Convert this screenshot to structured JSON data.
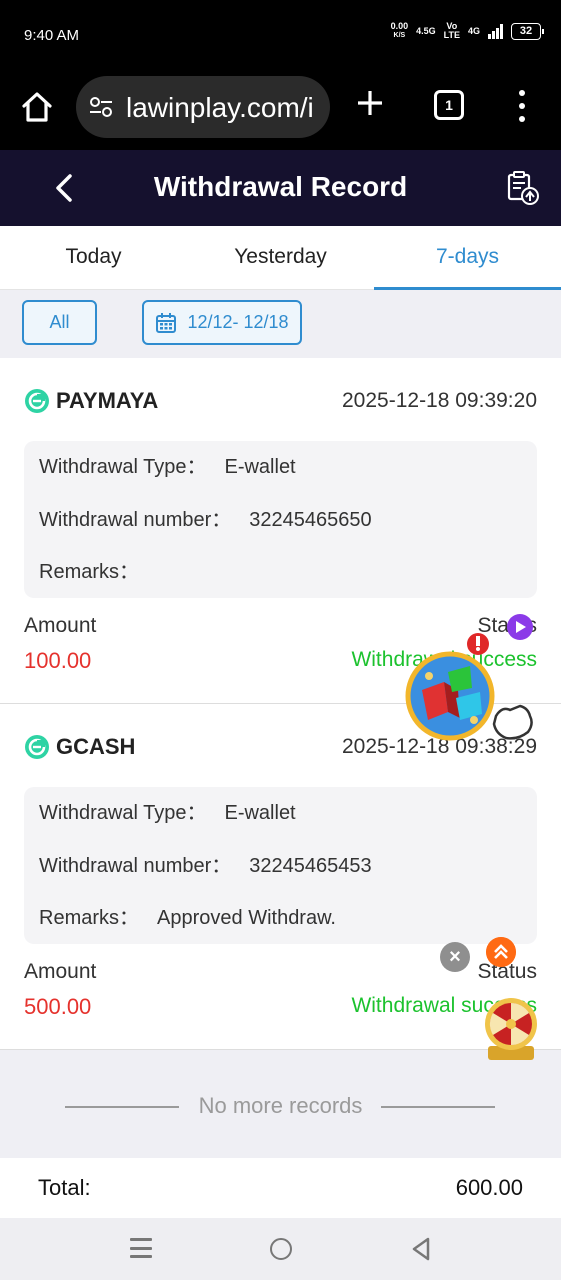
{
  "status_bar": {
    "time": "9:40 AM",
    "net_speed_value": "0.00",
    "net_speed_unit": "K/S",
    "network_1": "4.5G",
    "network_volte_top": "Vo",
    "network_volte_bottom": "LTE",
    "network_2": "4G",
    "battery": "32"
  },
  "browser": {
    "url": "lawinplay.com/i",
    "tabs_count": "1"
  },
  "app_header": {
    "title": "Withdrawal Record"
  },
  "tabs": [
    {
      "label": "Today",
      "active": false
    },
    {
      "label": "Yesterday",
      "active": false
    },
    {
      "label": "7-days",
      "active": true
    }
  ],
  "filters": {
    "type_label": "All",
    "date_range": "12/12- 12/18"
  },
  "records": [
    {
      "method": "PAYMAYA",
      "datetime": "2025-12-18 09:39:20",
      "type_label": "Withdrawal Type：",
      "type_value": "E-wallet",
      "number_label": "Withdrawal number：",
      "number_value": "32245465650",
      "remarks_label": "Remarks：",
      "remarks_value": "",
      "amount_label": "Amount",
      "amount_value": "100.00",
      "status_label": "Status",
      "status_value": "Withdrawal success"
    },
    {
      "method": "GCASH",
      "datetime": "2025-12-18 09:38:29",
      "type_label": "Withdrawal Type：",
      "type_value": "E-wallet",
      "number_label": "Withdrawal number：",
      "number_value": "32245465453",
      "remarks_label": "Remarks：",
      "remarks_value": "Approved Withdraw.",
      "amount_label": "Amount",
      "amount_value": "500.00",
      "status_label": "Status",
      "status_value": "Withdrawal success"
    }
  ],
  "footer": {
    "no_more": "No more records",
    "total_label": "Total:",
    "total_value": "600.00"
  },
  "colors": {
    "accent": "#2f8ccf",
    "header_bg": "#15112e",
    "amount": "#e5322d",
    "success": "#1cc22e"
  },
  "icons": [
    "home-icon",
    "site-settings-icon",
    "plus-icon",
    "tabs-icon",
    "more-icon",
    "back-icon",
    "export-record-icon",
    "calendar-icon",
    "wallet-logo-icon",
    "close-icon",
    "scroll-top-icon"
  ]
}
